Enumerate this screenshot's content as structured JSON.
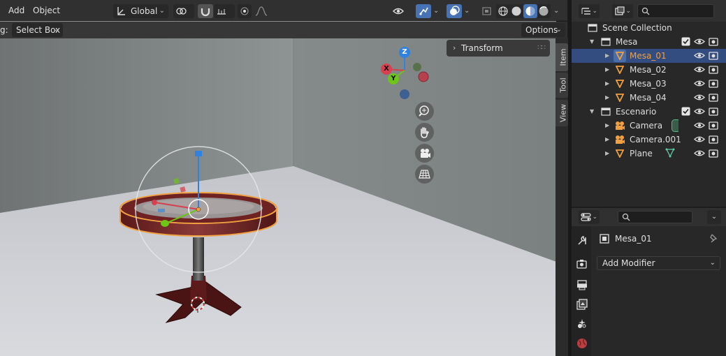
{
  "header": {
    "menu": [
      "Add",
      "Object"
    ],
    "orientation_label": "Global"
  },
  "tool_header": {
    "drag_prefix": "g:",
    "select_mode": "Select Box",
    "options_label": "Options"
  },
  "sidebar": {
    "panel_title": "Transform",
    "tabs": [
      "Item",
      "Tool",
      "View"
    ]
  },
  "gizmo": {
    "axis_x": "X",
    "axis_y": "Y",
    "axis_z": "Z"
  },
  "outliner": {
    "rows": [
      {
        "label": "Scene Collection",
        "type": "scene"
      },
      {
        "label": "Mesa",
        "type": "collection"
      },
      {
        "label": "Mesa_01",
        "type": "mesh",
        "selected": true
      },
      {
        "label": "Mesa_02",
        "type": "mesh"
      },
      {
        "label": "Mesa_03",
        "type": "mesh"
      },
      {
        "label": "Mesa_04",
        "type": "mesh"
      },
      {
        "label": "Escenario",
        "type": "collection"
      },
      {
        "label": "Camera",
        "type": "camera"
      },
      {
        "label": "Camera.001",
        "type": "camera"
      },
      {
        "label": "Plane",
        "type": "mesh"
      }
    ]
  },
  "properties": {
    "object_name": "Mesa_01",
    "add_modifier_label": "Add Modifier"
  },
  "colors": {
    "accent_blue": "#4772b3",
    "selection_orange": "#f0a040",
    "axis_x": "#d7404f",
    "axis_y": "#6ec417",
    "axis_z": "#2f82e0"
  }
}
